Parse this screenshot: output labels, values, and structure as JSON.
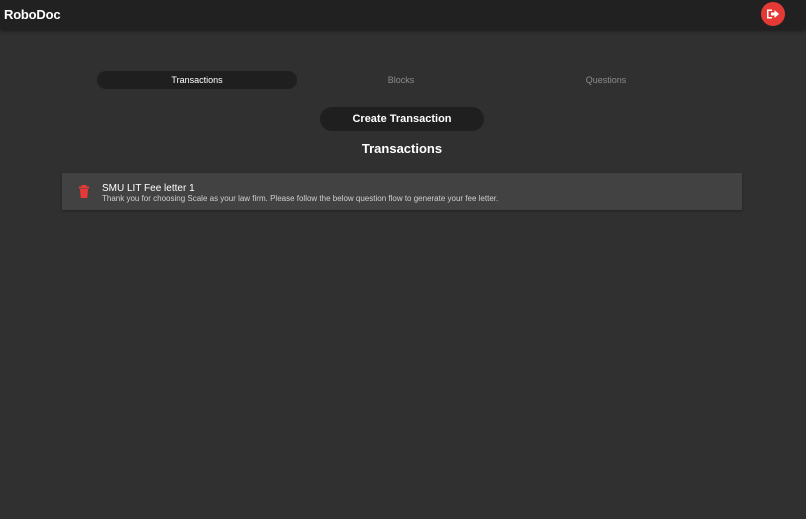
{
  "app": {
    "title": "RoboDoc",
    "logout_icon": "logout-icon",
    "accent_color": "#e53935"
  },
  "tabs": [
    {
      "label": "Transactions",
      "active": true
    },
    {
      "label": "Blocks",
      "active": false
    },
    {
      "label": "Questions",
      "active": false
    }
  ],
  "create_button": {
    "label": "Create Transaction"
  },
  "section": {
    "title": "Transactions"
  },
  "transactions": [
    {
      "title": "SMU LIT Fee letter 1",
      "description": "Thank you for choosing Scale as your law firm. Please follow the below question flow to generate your fee letter.",
      "delete_icon": "trash-icon"
    }
  ]
}
